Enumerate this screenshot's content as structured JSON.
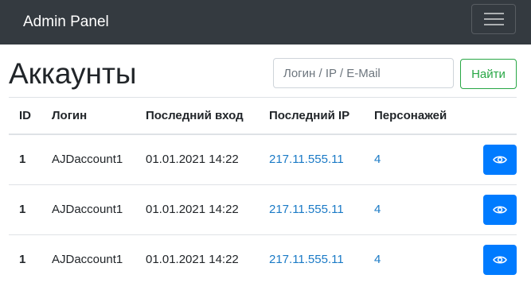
{
  "navbar": {
    "brand": "Admin Panel",
    "toggler_icon": "hamburger-menu-icon",
    "background": "#343a40"
  },
  "page": {
    "title": "Аккаунты"
  },
  "search": {
    "placeholder": "Логин / IP / E-Mail",
    "value": "",
    "button_label": "Найти",
    "button_color": "#28a745"
  },
  "table": {
    "columns": [
      "ID",
      "Логин",
      "Последний вход",
      "Последний IP",
      "Персонажей",
      ""
    ],
    "rows": [
      {
        "id": "1",
        "login": "AJDaccount1",
        "last_login": "01.01.2021 14:22",
        "last_ip": "217.11.555.11",
        "characters": "4",
        "action_icon": "eye-icon"
      },
      {
        "id": "1",
        "login": "AJDaccount1",
        "last_login": "01.01.2021 14:22",
        "last_ip": "217.11.555.11",
        "characters": "4",
        "action_icon": "eye-icon"
      },
      {
        "id": "1",
        "login": "AJDaccount1",
        "last_login": "01.01.2021 14:22",
        "last_ip": "217.11.555.11",
        "characters": "4",
        "action_icon": "eye-icon"
      }
    ],
    "link_color": "#1a7ac6",
    "action_button_color": "#007bff"
  }
}
